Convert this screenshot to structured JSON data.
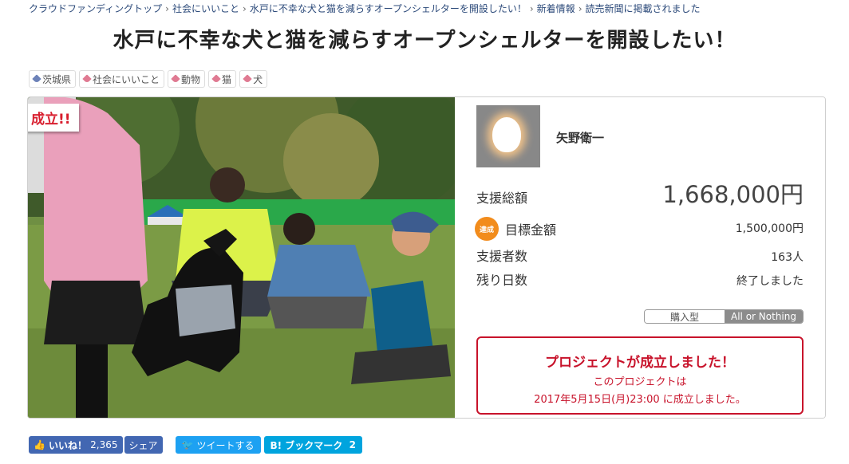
{
  "breadcrumb": [
    {
      "label": "クラウドファンディングトップ"
    },
    {
      "label": "社会にいいこと"
    },
    {
      "label": "水戸に不幸な犬と猫を減らすオープンシェルターを開設したい！"
    },
    {
      "label": "新着情報"
    },
    {
      "label": "読売新聞に掲載されました"
    }
  ],
  "breadcrumb_separator": "›",
  "title": "水戸に不幸な犬と猫を減らすオープンシェルターを開設したい！",
  "tags": [
    {
      "label": "茨城県",
      "icon": "location-tag-icon"
    },
    {
      "label": "社会にいいこと",
      "icon": "tag-icon"
    },
    {
      "label": "動物",
      "icon": "tag-icon"
    },
    {
      "label": "猫",
      "icon": "tag-icon"
    },
    {
      "label": "犬",
      "icon": "tag-icon"
    }
  ],
  "ribbon": "成立!!",
  "owner": {
    "name": "矢野衛一"
  },
  "stats": {
    "total_label": "支援総額",
    "total_value": "1,668,000円",
    "goal_badge": "達成",
    "goal_label": "目標金額",
    "goal_value": "1,500,000円",
    "backers_label": "支援者数",
    "backers_value": "163人",
    "days_label": "残り日数",
    "days_value": "終了しました"
  },
  "project_type": {
    "option_1": "購入型",
    "option_2": "All or Nothing",
    "selected": "All or Nothing"
  },
  "success": {
    "heading": "プロジェクトが成立しました！",
    "line1": "このプロジェクトは",
    "line2": "2017年5月15日(月)23:00 に成立しました。"
  },
  "social": {
    "like_label": "いいね！",
    "like_count": "2,365",
    "share_label": "シェア",
    "tweet_label": "ツイートする",
    "bookmark_label": "B! ブックマーク",
    "bookmark_count": "2"
  },
  "colors": {
    "accent_red": "#c8132b",
    "facebook": "#4267b2",
    "twitter": "#1da1f2",
    "hatena": "#00a4de",
    "badge": "#f28c1c"
  }
}
